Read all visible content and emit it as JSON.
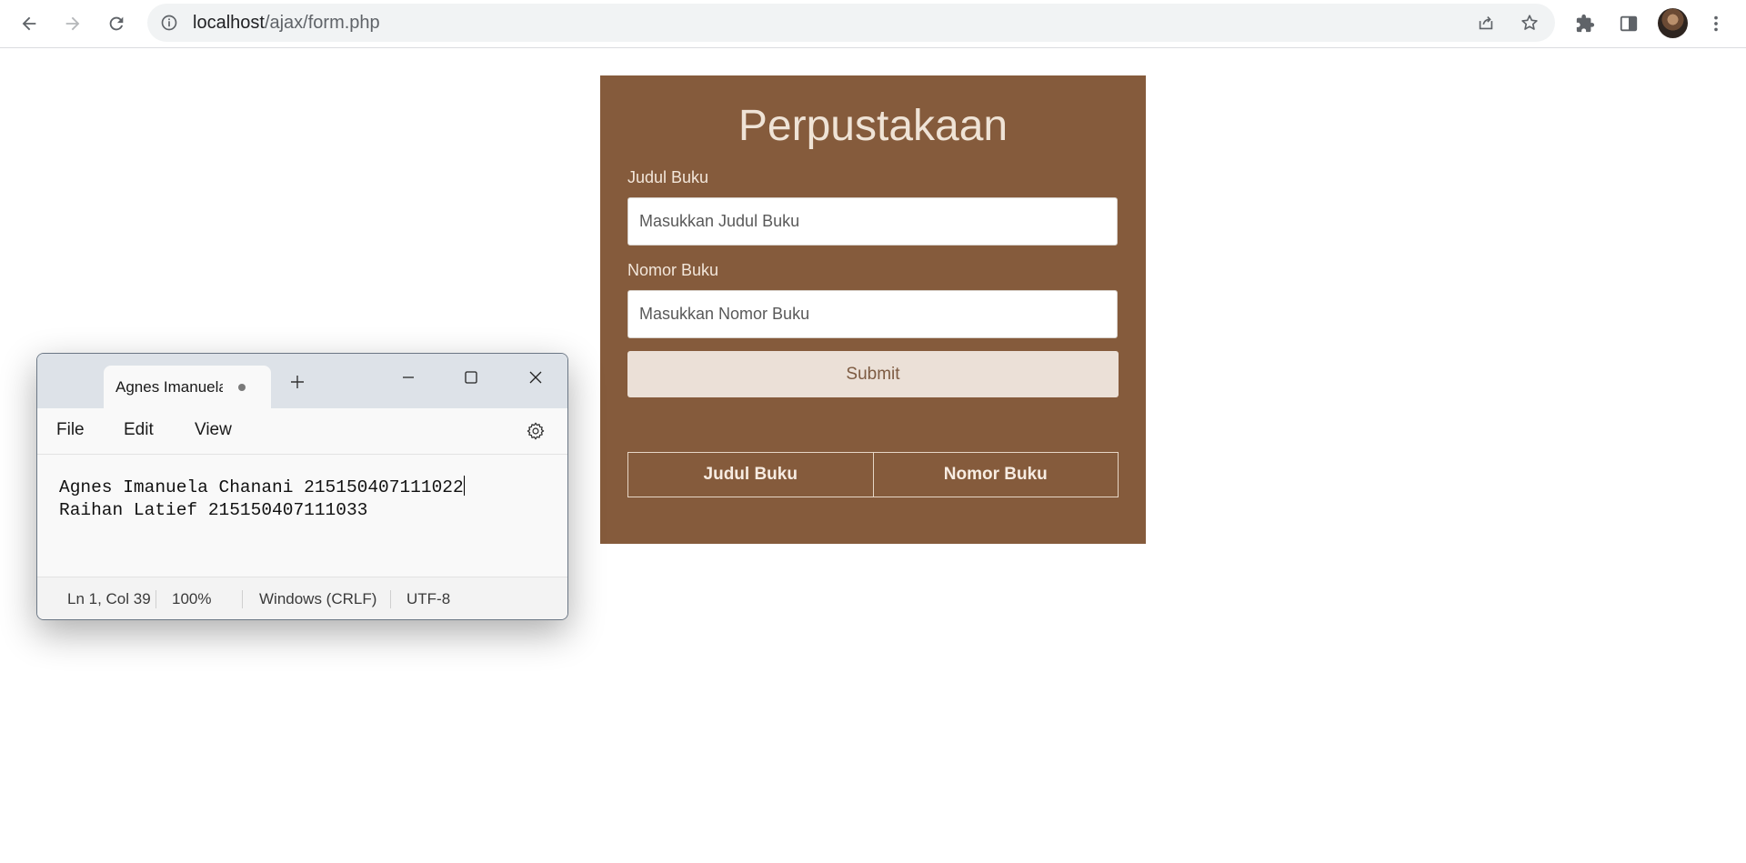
{
  "browser": {
    "url_host": "localhost",
    "url_path": "/ajax/form.php",
    "icons": [
      "back-icon",
      "forward-icon",
      "reload-icon",
      "site-info-icon",
      "share-icon",
      "bookmark-star-icon",
      "extensions-icon",
      "side-panel-icon",
      "profile-avatar",
      "menu-kebab-icon"
    ]
  },
  "form": {
    "title": "Perpustakaan",
    "judul_label": "Judul Buku",
    "judul_placeholder": "Masukkan Judul Buku",
    "nomor_label": "Nomor Buku",
    "nomor_placeholder": "Masukkan Nomor Buku",
    "submit_label": "Submit",
    "table_headers": [
      "Judul Buku",
      "Nomor Buku"
    ],
    "colors": {
      "panel": "#855b3c",
      "button": "#ebe0d7"
    }
  },
  "notepad": {
    "tab_title": "Agnes Imanuela Chanani",
    "menu": [
      "File",
      "Edit",
      "View"
    ],
    "lines": [
      "Agnes Imanuela Chanani 215150407111022",
      "Raihan Latief 215150407111033"
    ],
    "status": {
      "position": "Ln 1, Col 39",
      "zoom": "100%",
      "line_ending": "Windows (CRLF)",
      "encoding": "UTF-8"
    }
  }
}
